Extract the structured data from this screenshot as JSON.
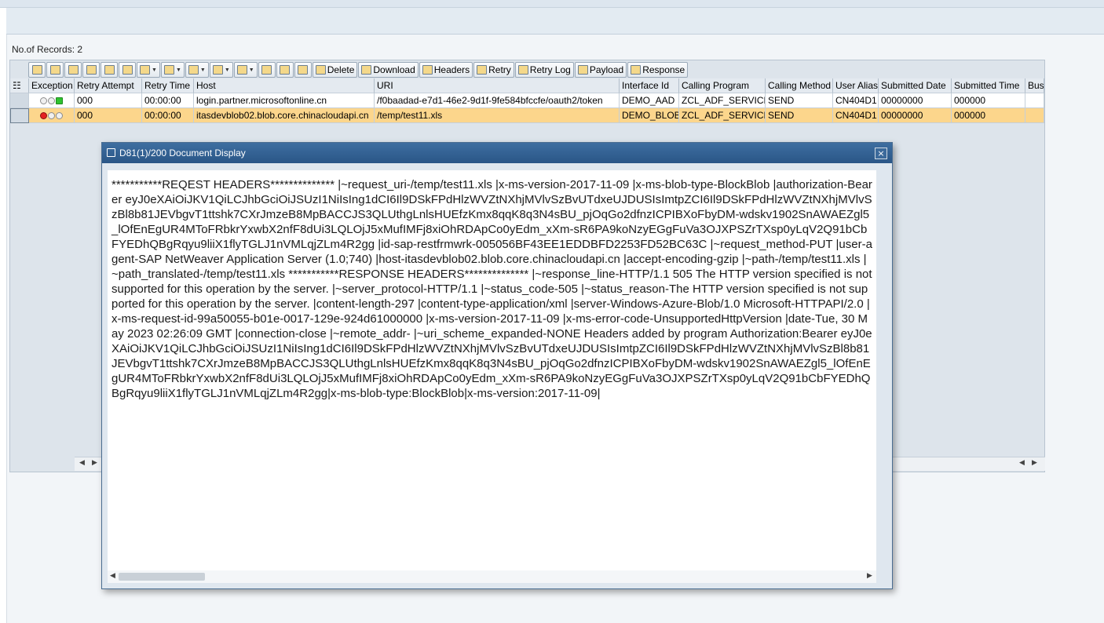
{
  "header": {
    "records_label": "No.of Records: 2"
  },
  "toolbar": {
    "buttons": [
      {
        "icon": "layout-icon"
      },
      {
        "icon": "details-icon"
      },
      {
        "icon": "find-icon"
      },
      {
        "icon": "find-next-icon"
      },
      {
        "icon": "chart-icon"
      },
      {
        "icon": "info-icon"
      },
      {
        "icon": "export-icon"
      },
      {
        "icon": "filter-icon"
      },
      {
        "icon": "clear-filter-icon"
      },
      {
        "icon": "sum-icon"
      },
      {
        "icon": "subtotal-icon"
      },
      {
        "icon": "print-icon"
      },
      {
        "icon": "sort-asc-icon"
      },
      {
        "icon": "sort-desc-icon"
      }
    ],
    "delete_label": "Delete",
    "download_label": "Download",
    "headers_label": "Headers",
    "retry_label": "Retry",
    "retry_log_label": "Retry Log",
    "payload_label": "Payload",
    "response_label": "Response"
  },
  "grid": {
    "columns": [
      "Exception",
      "Retry Attempt",
      "Retry Time",
      "Host",
      "URI",
      "Interface Id",
      "Calling Program",
      "Calling Method",
      "User Alias",
      "Submitted Date",
      "Submitted Time",
      "Busi"
    ],
    "rows": [
      {
        "exception": "green",
        "retry_attempt": "000",
        "retry_time": "00:00:00",
        "host": "login.partner.microsoftonline.cn",
        "uri": "/f0baadad-e7d1-46e2-9d1f-9fe584bfccfe/oauth2/token",
        "interface_id": "DEMO_AAD",
        "calling_program": "ZCL_ADF_SERVICE",
        "calling_method": "SEND",
        "user_alias": "CN404D1",
        "submitted_date": "00000000",
        "submitted_time": "000000"
      },
      {
        "exception": "red",
        "retry_attempt": "000",
        "retry_time": "00:00:00",
        "host": "itasdevblob02.blob.core.chinacloudapi.cn",
        "uri": "/temp/test11.xls",
        "interface_id": "DEMO_BLOB",
        "calling_program": "ZCL_ADF_SERVICE",
        "calling_method": "SEND",
        "user_alias": "CN404D1",
        "submitted_date": "00000000",
        "submitted_time": "000000"
      }
    ]
  },
  "dialog": {
    "title": "D81(1)/200 Document Display",
    "close_label": "×",
    "text": "***********REQEST HEADERS************** |~request_uri-/temp/test11.xls |x-ms-version-2017-11-09 |x-ms-blob-type-BlockBlob |authorization-Bearer eyJ0eXAiOiJKV1QiLCJhbGciOiJSUzI1NiIsIng1dCI6Il9DSkFPdHlzWVZtNXhjMVlvSzBvUTdxeUJDUSIsImtpZCI6Il9DSkFPdHlzWVZtNXhjMVlvSzBl8b81JEVbgvT1ttshk7CXrJmzeB8MpBACCJS3QLUthgLnlsHUEfzKmx8qqK8q3N4sBU_pjOqGo2dfnzICPIBXoFbyDM-wdskv1902SnAWAEZgl5_lOfEnEgUR4MToFRbkrYxwbX2nfF8dUi3LQLOjJ5xMufIMFj8xiOhRDApCo0yEdm_xXm-sR6PA9koNzyEGgFuVa3OJXPSZrTXsp0yLqV2Q91bCbFYEDhQBgRqyu9liiX1flyTGLJ1nVMLqjZLm4R2gg |id-sap-restfrmwrk-005056BF43EE1EDDBFD2253FD52BC63C |~request_method-PUT |user-agent-SAP NetWeaver Application Server (1.0;740) |host-itasdevblob02.blob.core.chinacloudapi.cn |accept-encoding-gzip |~path-/temp/test11.xls |~path_translated-/temp/test11.xls ***********RESPONSE HEADERS************** |~response_line-HTTP/1.1 505 The HTTP version specified is not supported for this operation by the server. |~server_protocol-HTTP/1.1 |~status_code-505 |~status_reason-The HTTP version specified is not supported for this operation by the server. |content-length-297 |content-type-application/xml |server-Windows-Azure-Blob/1.0 Microsoft-HTTPAPI/2.0 |x-ms-request-id-99a50055-b01e-0017-129e-924d61000000 |x-ms-version-2017-11-09 |x-ms-error-code-UnsupportedHttpVersion |date-Tue, 30 May 2023 02:26:09 GMT |connection-close |~remote_addr- |~uri_scheme_expanded-NONE Headers added by program Authorization:Bearer eyJ0eXAiOiJKV1QiLCJhbGciOiJSUzI1NiIsIng1dCI6Il9DSkFPdHlzWVZtNXhjMVlvSzBvUTdxeUJDUSIsImtpZCI6Il9DSkFPdHlzWVZtNXhjMVlvSzBl8b81JEVbgvT1ttshk7CXrJmzeB8MpBACCJS3QLUthgLnlsHUEfzKmx8qqK8q3N4sBU_pjOqGo2dfnzICPIBXoFbyDM-wdskv1902SnAWAEZgl5_lOfEnEgUR4MToFRbkrYxwbX2nfF8dUi3LQLOjJ5xMufIMFj8xiOhRDApCo0yEdm_xXm-sR6PA9koNzyEGgFuVa3OJXPSZrTXsp0yLqV2Q91bCbFYEDhQBgRqyu9liiX1flyTGLJ1nVMLqjZLm4R2gg|x-ms-blob-type:BlockBlob|x-ms-version:2017-11-09|"
  },
  "colors": {
    "selected_row": "#fcd68c",
    "dialog_title_bg": "#2a5687",
    "green_light": "#2fc22f",
    "red_light": "#e42121"
  }
}
